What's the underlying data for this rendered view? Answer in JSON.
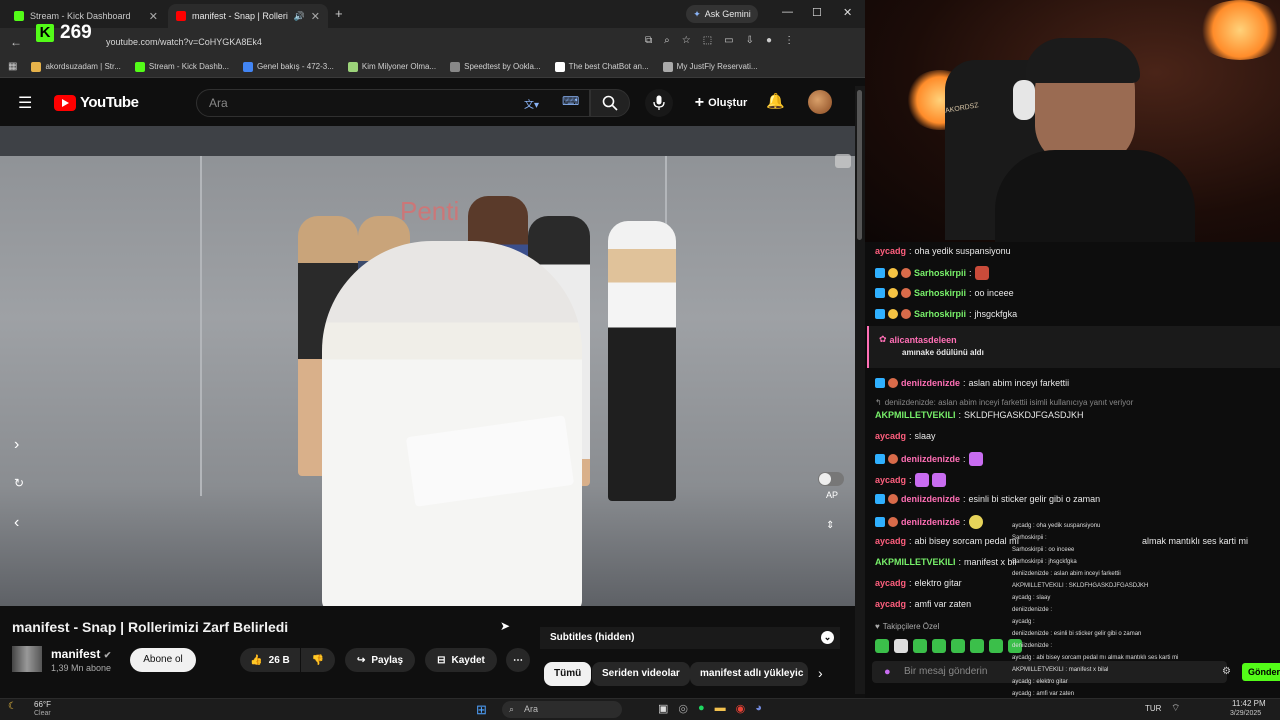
{
  "browser": {
    "tabs": [
      {
        "label": "Stream - Kick Dashboard",
        "favicon_color": "#53fc18"
      },
      {
        "label": "manifest - Snap | Rollerimiz",
        "favicon_color": "#ff0000"
      }
    ],
    "gemini_label": "Ask Gemini",
    "url": "youtube.com/watch?v=CoHYGKA8Ek4",
    "bookmarks": [
      "akordsuzadam | Str...",
      "Stream - Kick Dashb...",
      "Genel bakış - 472-3...",
      "Kim Milyoner Olma...",
      "Speedtest by Ookla...",
      "The best ChatBot an...",
      "My JustFly Reservati..."
    ]
  },
  "kick_overlay": {
    "viewer_count": "269"
  },
  "youtube": {
    "logo_text": "YouTube",
    "search_placeholder": "Ara",
    "create_label": "Oluştur",
    "video_side_label": "AP",
    "video_title": "manifest - Snap | Rollerimizi Zarf Belirledi",
    "channel_name": "manifest",
    "subscribers": "1,39 Mn abone",
    "subscribe_label": "Abone ol",
    "like_count": "26 B",
    "share_label": "Paylaş",
    "save_label": "Kaydet",
    "subtitles_label": "Subtitles (hidden)",
    "chips": [
      "Tümü",
      "Seriden videolar",
      "manifest adlı yükleyic"
    ]
  },
  "chat": {
    "messages": [
      {
        "user": "aycadg",
        "text": "oha yedik suspansiyonu",
        "color": "red"
      },
      {
        "user": "Sarhoskirpii",
        "text": "",
        "color": "green"
      },
      {
        "user": "Sarhoskirpii",
        "text": "oo inceee",
        "color": "green"
      },
      {
        "user": "Sarhoskirpii",
        "text": "jhsgckfgka",
        "color": "green"
      },
      {
        "user": "alicantasdeleen",
        "text": "amınake ödülünü aldı",
        "color": "pink"
      },
      {
        "user": "deniizdenizde",
        "text": "aslan abim inceyi farkettii",
        "color": "pink"
      },
      {
        "user": "reply",
        "text": "deniizdenizde: aslan abim inceyi farkettii isimli kullanıcıya yanıt veriyor",
        "color": "grey"
      },
      {
        "user": "AKPMILLETVEKILI",
        "text": "SKLDFHGASKDJFGASDJKH",
        "color": "green"
      },
      {
        "user": "aycadg",
        "text": "slaay",
        "color": "red"
      },
      {
        "user": "deniizdenizde",
        "text": "",
        "color": "pink"
      },
      {
        "user": "aycadg",
        "text": "",
        "color": "red"
      },
      {
        "user": "deniizdenizde",
        "text": "esinli bi sticker gelir gibi o zaman",
        "color": "pink"
      },
      {
        "user": "deniizdenizde",
        "text": "",
        "color": "pink"
      },
      {
        "user": "aycadg",
        "text": "abi bisey sorcam pedal mı",
        "color": "red"
      },
      {
        "user": "AKPMILLETVEKILI",
        "text": "manifest x bil",
        "color": "green"
      },
      {
        "user": "aycadg",
        "text": "elektro gitar",
        "color": "red"
      },
      {
        "user": "aycadg",
        "text": "amfi var zaten",
        "color": "red"
      }
    ],
    "follower_only": "Takipçilere Özel",
    "input_placeholder": "Bir mesaj gönderin",
    "send_label": "Gönder",
    "overlay_lines": [
      "aycadg : oha yedik suspansiyonu",
      "Sarhoskirpii :",
      "Sarhoskirpii : oo inceee",
      "Sarhoskirpii : jhsgckfgka",
      "deniizdenizde : aslan abim inceyi farkettii",
      "AKPMILLETVEKILI : SKLDFHGASKDJFGASDJKH",
      "aycadg : slaay",
      "deniizdenizde :",
      "aycadg :",
      "deniizdenizde : esinli bi sticker gelir gibi o zaman",
      "deniizdenizde :",
      "aycadg : abi bisey sorcam pedal mı almak mantıklı ses karti mi",
      "AKPMILLETVEKILI : manifest x bilal",
      "aycadg : elektro gitar",
      "aycadg : amfi var zaten"
    ],
    "overflow_text": "almak mantıklı ses karti mi"
  },
  "taskbar": {
    "weather_temp": "66°F",
    "weather_desc": "Clear",
    "search_label": "Ara",
    "lang": "TUR",
    "time": "11:42 PM",
    "date": "3/29/2025"
  },
  "colors": {
    "kick_green": "#53fc18",
    "youtube_red": "#ff0000"
  }
}
